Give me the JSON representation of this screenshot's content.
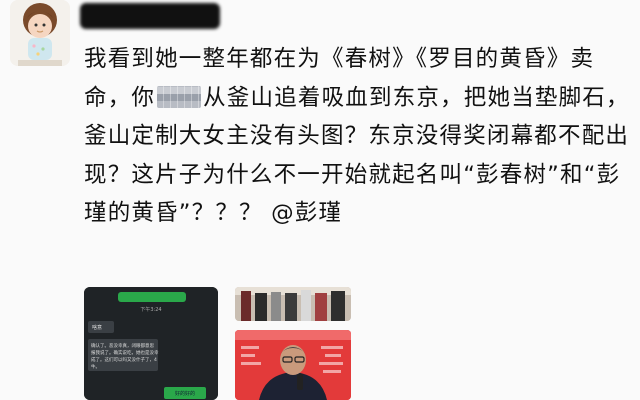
{
  "post": {
    "text_segments": {
      "before_mosaic": "我看到她一整年都在为《春树》《罗目的黄昏》卖命，你",
      "after_mosaic": "从釜山追着吸血到东京，把她当垫脚石，釜山定制大女主没有头图？东京没得奖闭幕都不配出现？这片子为什么不一开始就起名叫“彭春树”和“彭瑾的黄昏”？？？ @彭瑾"
    }
  },
  "attachments": {
    "chat": {
      "time": "下午3:24",
      "msgs": [
        "啥意",
        "确认了。恶没幸真，闭眼都意思报我说了。确实说吃，她也是没幸成了。这们可以吗又没什子了，4牛。"
      ],
      "reply": "好的好的"
    }
  },
  "colors": {
    "page_bg": "#fafafa",
    "text": "#111111",
    "chat_bg": "#1f2326",
    "chat_green": "#2aa84a",
    "poster_red": "#e33a3a"
  }
}
